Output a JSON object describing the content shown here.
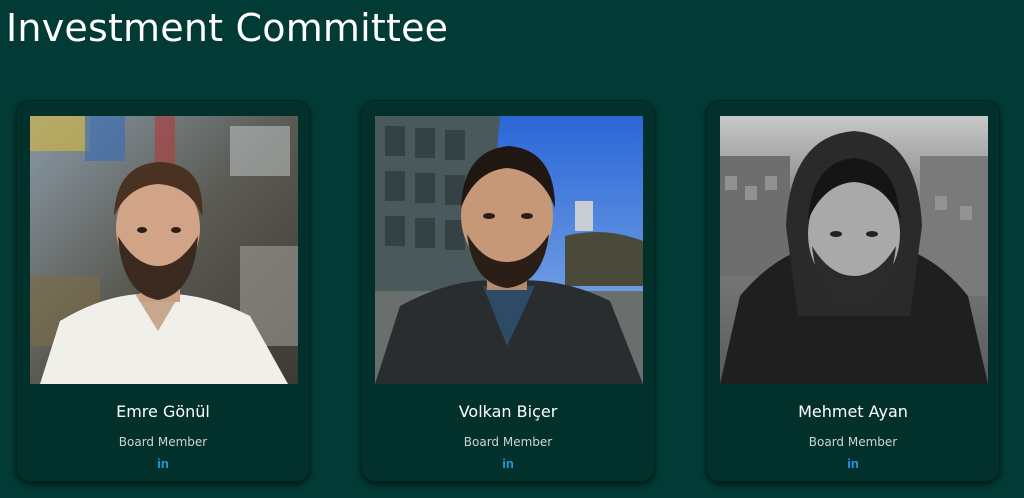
{
  "page": {
    "title": "Investment Committee"
  },
  "members": [
    {
      "name": "Emre Gönül",
      "role": "Board Member",
      "social": {
        "icon": "linkedin-icon",
        "glyph": "in"
      }
    },
    {
      "name": "Volkan Biçer",
      "role": "Board Member",
      "social": {
        "icon": "linkedin-icon",
        "glyph": "in"
      }
    },
    {
      "name": "Mehmet Ayan",
      "role": "Board Member",
      "social": {
        "icon": "linkedin-icon",
        "glyph": "in"
      }
    }
  ],
  "colors": {
    "background": "#023a35",
    "card": "#02302b",
    "linkedin": "#1e9be6"
  }
}
